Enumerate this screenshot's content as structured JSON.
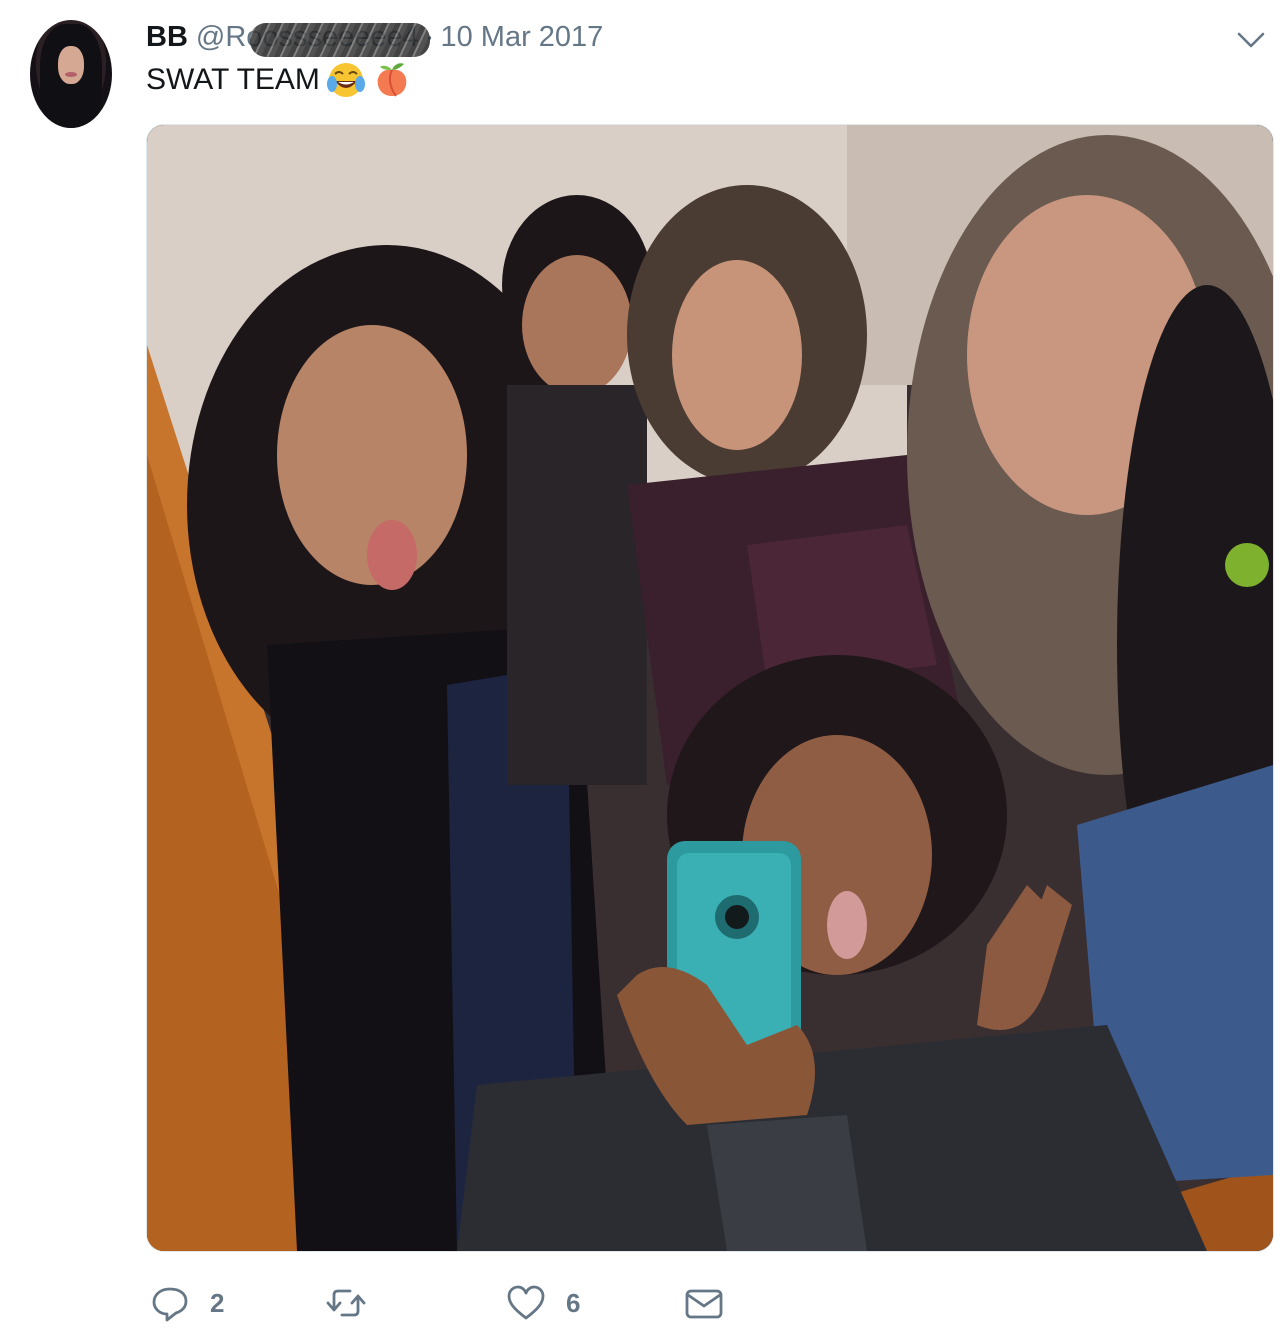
{
  "tweet": {
    "author_name": "BB",
    "handle": "@Roossseeeee4",
    "separator": "·",
    "date": "10 Mar 2017",
    "text": "SWAT TEAM",
    "emojis": [
      "face-with-tears-of-joy",
      "peach"
    ],
    "media_alt": "Group selfie of five friends in a mirror"
  },
  "actions": {
    "reply_count": "2",
    "retweet_count": "",
    "like_count": "6"
  },
  "colors": {
    "text_primary": "#14171a",
    "text_secondary": "#657786",
    "border": "#e1e8ed"
  },
  "icons": {
    "more": "chevron-down-icon",
    "reply": "reply-icon",
    "retweet": "retweet-icon",
    "like": "heart-icon",
    "dm": "envelope-icon"
  }
}
